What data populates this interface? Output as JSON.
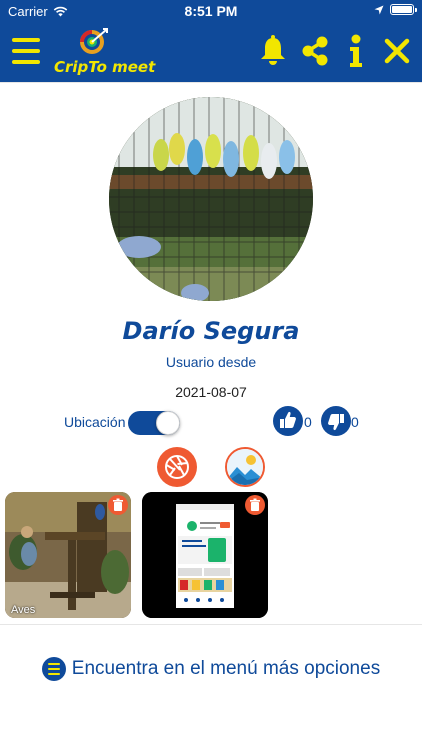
{
  "status_bar": {
    "carrier": "Carrier",
    "time": "8:51 PM"
  },
  "nav": {
    "logo_text": "CripTo meet",
    "icons": [
      "menu-icon",
      "bell-icon",
      "share-icon",
      "info-icon",
      "close-icon"
    ],
    "accent_color": "#f2e600",
    "bar_color": "#0f4a9a"
  },
  "profile": {
    "name": "Darío Segura",
    "member_since_label": "Usuario desde",
    "member_since_date": "2021-08-07"
  },
  "location": {
    "label": "Ubicación",
    "enabled": true
  },
  "ratings": {
    "likes": "0",
    "dislikes": "0"
  },
  "media_actions": {
    "icons": [
      "camera-icon",
      "gallery-icon"
    ],
    "accent_color": "#ef5a32"
  },
  "photos": [
    {
      "caption": "Aves"
    },
    {
      "caption": ""
    }
  ],
  "footer": {
    "hint": "Encuentra en el menú más opciones"
  }
}
